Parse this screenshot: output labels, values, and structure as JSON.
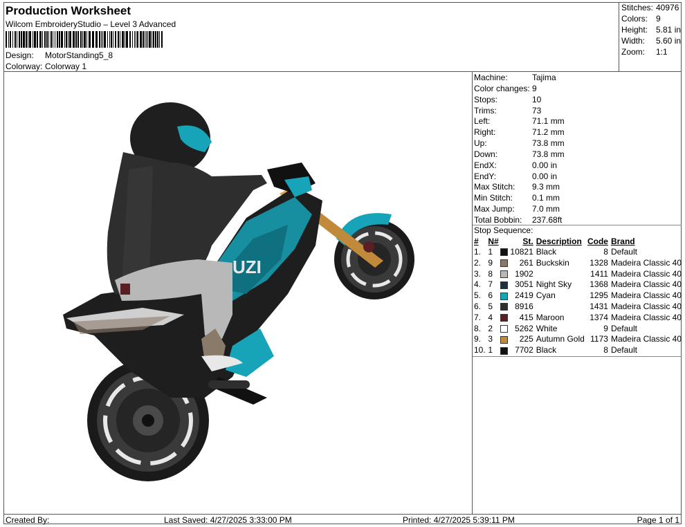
{
  "header": {
    "title": "Production Worksheet",
    "software": "Wilcom EmbroideryStudio – Level 3 Advanced",
    "design_label": "Design:",
    "design_value": "MotorStanding5_8",
    "colorway_label": "Colorway:",
    "colorway_value": "Colorway 1"
  },
  "summary": [
    {
      "label": "Stitches:",
      "value": "40976"
    },
    {
      "label": "Colors:",
      "value": "9"
    },
    {
      "label": "Height:",
      "value": "5.81 in"
    },
    {
      "label": "Width:",
      "value": "5.60 in"
    },
    {
      "label": "Zoom:",
      "value": "1:1"
    }
  ],
  "info": [
    {
      "label": "Machine:",
      "value": "Tajima"
    },
    {
      "label": "Color changes:",
      "value": "9"
    },
    {
      "label": "Stops:",
      "value": "10"
    },
    {
      "label": "Trims:",
      "value": "73"
    },
    {
      "label": "Left:",
      "value": "71.1 mm"
    },
    {
      "label": "Right:",
      "value": "71.2 mm"
    },
    {
      "label": "Up:",
      "value": "73.8 mm"
    },
    {
      "label": "Down:",
      "value": "73.8 mm"
    },
    {
      "label": "EndX:",
      "value": "0.00 in"
    },
    {
      "label": "EndY:",
      "value": "0.00 in"
    },
    {
      "label": "Max Stitch:",
      "value": "9.3 mm"
    },
    {
      "label": "Min Stitch:",
      "value": "0.1 mm"
    },
    {
      "label": "Max Jump:",
      "value": "7.0 mm"
    },
    {
      "label": "Total Bobbin:",
      "value": "237.68ft"
    }
  ],
  "stop_sequence": {
    "title": "Stop Sequence:",
    "columns": [
      "#",
      "N#",
      "St.",
      "Description",
      "Code",
      "Brand"
    ],
    "rows": [
      {
        "idx": "1.",
        "n": "1",
        "color": "#111111",
        "st": "10821",
        "desc": "Black",
        "code": "8",
        "brand": "Default"
      },
      {
        "idx": "2.",
        "n": "9",
        "color": "#8a7a6a",
        "st": "261",
        "desc": "Buckskin",
        "code": "1328",
        "brand": "Madeira Classic 40"
      },
      {
        "idx": "3.",
        "n": "8",
        "color": "#b8b8b8",
        "st": "1902",
        "desc": "",
        "code": "1411",
        "brand": "Madeira Classic 40"
      },
      {
        "idx": "4.",
        "n": "7",
        "color": "#1f3140",
        "st": "3051",
        "desc": "Night Sky",
        "code": "1368",
        "brand": "Madeira Classic 40"
      },
      {
        "idx": "5.",
        "n": "6",
        "color": "#17a3b8",
        "st": "2419",
        "desc": "Cyan",
        "code": "1295",
        "brand": "Madeira Classic 40"
      },
      {
        "idx": "6.",
        "n": "5",
        "color": "#2e2e2e",
        "st": "8916",
        "desc": "",
        "code": "1431",
        "brand": "Madeira Classic 40"
      },
      {
        "idx": "7.",
        "n": "4",
        "color": "#5a1f24",
        "st": "415",
        "desc": "Maroon",
        "code": "1374",
        "brand": "Madeira Classic 40"
      },
      {
        "idx": "8.",
        "n": "2",
        "color": "#ffffff",
        "st": "5262",
        "desc": "White",
        "code": "9",
        "brand": "Default"
      },
      {
        "idx": "9.",
        "n": "3",
        "color": "#c08a3a",
        "st": "225",
        "desc": "Autumn Gold",
        "code": "1173",
        "brand": "Madeira Classic 40"
      },
      {
        "idx": "10.",
        "n": "1",
        "color": "#111111",
        "st": "7702",
        "desc": "Black",
        "code": "8",
        "brand": "Default"
      }
    ]
  },
  "footer": {
    "created": "Created By:",
    "saved": "Last Saved: 4/27/2025 3:33:00 PM",
    "printed": "Printed: 4/27/2025 5:39:11 PM",
    "page": "Page 1 of 1"
  }
}
